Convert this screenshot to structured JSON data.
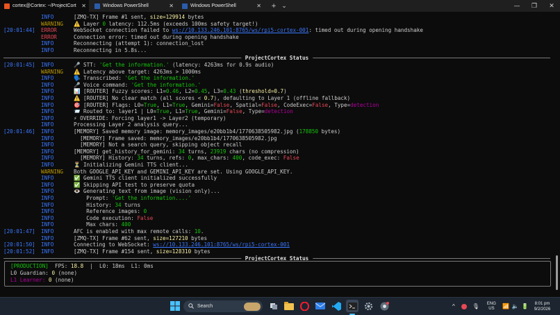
{
  "tabs": [
    {
      "label": "cortex@Cortex: ~/ProjectCort",
      "active": true
    },
    {
      "label": "Windows PowerShell",
      "active": false
    },
    {
      "label": "Windows PowerShell",
      "active": false
    }
  ],
  "tab_controls": {
    "new_tab": "+",
    "dropdown": "⌄"
  },
  "window_controls": {
    "minimize": "—",
    "maximize": "❐",
    "close": "✕"
  },
  "log_block_1": [
    {
      "ts": "",
      "level": "INFO",
      "cls": "",
      "parts": [
        [
          "[ZMQ-TX] Frame #1 sent, ",
          ""
        ],
        [
          "size=129914",
          "yel"
        ],
        [
          " bytes",
          ""
        ]
      ]
    },
    {
      "ts": "",
      "level": "WARNING",
      "cls": "warn",
      "parts": [
        [
          "⚠️ Layer ",
          ""
        ],
        [
          "0",
          "grn"
        ],
        [
          " latency: 112.5ms (exceeds 100ms safety target!)",
          ""
        ]
      ]
    },
    {
      "ts": "[20:01:44]",
      "level": "ERROR",
      "cls": "err",
      "parts": [
        [
          "WebSocket connection failed to ",
          ""
        ],
        [
          "ws://10.133.246.101:8765/ws/rpi5-cortex-001",
          "und"
        ],
        [
          ": timed out during opening handshake",
          ""
        ]
      ]
    },
    {
      "ts": "",
      "level": "ERROR",
      "cls": "err",
      "parts": [
        [
          "Connection error: timed out during opening handshake",
          ""
        ]
      ]
    },
    {
      "ts": "",
      "level": "INFO",
      "cls": "",
      "parts": [
        [
          "Reconnecting (attempt 1): connection_lost",
          ""
        ]
      ]
    },
    {
      "ts": "",
      "level": "INFO",
      "cls": "",
      "parts": [
        [
          "Reconnecting in 5.8s...",
          ""
        ]
      ]
    }
  ],
  "status_title_1": "ProjectCortex Status",
  "log_block_2": [
    {
      "ts": "[20:01:45]",
      "level": "INFO",
      "cls": "",
      "parts": [
        [
          "🎤 STT: ",
          ""
        ],
        [
          "'Get the information.'",
          "grn"
        ],
        [
          " (latency: 4263ms for 0.9s audio)",
          ""
        ]
      ]
    },
    {
      "ts": "",
      "level": "WARNING",
      "cls": "warn",
      "parts": [
        [
          "⚠️ Latency above target: 4263ms > 1000ms",
          ""
        ]
      ]
    },
    {
      "ts": "",
      "level": "INFO",
      "cls": "",
      "parts": [
        [
          "🗣️ Transcribed: ",
          ""
        ],
        [
          "'Get the information.'",
          "grn"
        ]
      ]
    },
    {
      "ts": "",
      "level": "INFO",
      "cls": "",
      "parts": [
        [
          "🎤 Voice command: ",
          ""
        ],
        [
          "'Get the information.'",
          "grn"
        ]
      ]
    },
    {
      "ts": "",
      "level": "INFO",
      "cls": "",
      "parts": [
        [
          "📊 [ROUTER] Fuzzy scores: L1=",
          ""
        ],
        [
          "0.46",
          "grn"
        ],
        [
          ", L2=",
          ""
        ],
        [
          "0.45",
          "grn"
        ],
        [
          ", L3=",
          ""
        ],
        [
          "0.43",
          "grn"
        ],
        [
          " (",
          ""
        ],
        [
          "threshold=0.7",
          "yel"
        ],
        [
          ")",
          ""
        ]
      ]
    },
    {
      "ts": "",
      "level": "INFO",
      "cls": "",
      "parts": [
        [
          "⚠️ [ROUTER] No clear match (all scores < ",
          ""
        ],
        [
          "0.7",
          "yel"
        ],
        [
          "), defaulting to Layer 1 (offline fallback)",
          ""
        ]
      ]
    },
    {
      "ts": "",
      "level": "INFO",
      "cls": "",
      "parts": [
        [
          "🎯 [ROUTER] Flags: L0=",
          ""
        ],
        [
          "True",
          "grn"
        ],
        [
          ", L1=",
          ""
        ],
        [
          "True",
          "grn"
        ],
        [
          ", Gemini=",
          ""
        ],
        [
          "False",
          "red"
        ],
        [
          ", Spatial=",
          ""
        ],
        [
          "False",
          "red"
        ],
        [
          ", CodeExec=",
          ""
        ],
        [
          "False",
          "red"
        ],
        [
          ", Type=",
          ""
        ],
        [
          "detection",
          "mag"
        ]
      ]
    },
    {
      "ts": "",
      "level": "INFO",
      "cls": "",
      "parts": [
        [
          "📨 Routed to: layer1 | L0=",
          ""
        ],
        [
          "True",
          "grn"
        ],
        [
          ", L1=",
          ""
        ],
        [
          "True",
          "grn"
        ],
        [
          ", Gemini=",
          ""
        ],
        [
          "False",
          "red"
        ],
        [
          ", Type=",
          ""
        ],
        [
          "detection",
          "mag"
        ]
      ]
    },
    {
      "ts": "",
      "level": "INFO",
      "cls": "",
      "parts": [
        [
          "⚡ OVERRIDE: Forcing layer1 -> Layer2 (temporary)",
          ""
        ]
      ]
    },
    {
      "ts": "",
      "level": "INFO",
      "cls": "",
      "parts": [
        [
          "Processing Layer 2 analysis query...",
          ""
        ]
      ]
    },
    {
      "ts": "[20:01:46]",
      "level": "INFO",
      "cls": "",
      "parts": [
        [
          "[MEMORY] Saved memory image: memory_images/e20bb1b4/1770638505982.jpg (",
          ""
        ],
        [
          "178850",
          "grn"
        ],
        [
          " bytes)",
          ""
        ]
      ]
    },
    {
      "ts": "",
      "level": "INFO",
      "cls": "",
      "parts": [
        [
          "  [MEMORY] Frame saved: memory_images/e20bb1b4/1770638505982.jpg",
          ""
        ]
      ]
    },
    {
      "ts": "",
      "level": "INFO",
      "cls": "",
      "parts": [
        [
          "  [MEMORY] Not a search query, skipping object recall",
          ""
        ]
      ]
    },
    {
      "ts": "",
      "level": "INFO",
      "cls": "",
      "parts": [
        [
          "[MEMORY] get_history_for_gemini: ",
          ""
        ],
        [
          "34",
          "grn"
        ],
        [
          " turns, ",
          ""
        ],
        [
          "23919",
          "grn"
        ],
        [
          " chars (no compression)",
          ""
        ]
      ]
    },
    {
      "ts": "",
      "level": "INFO",
      "cls": "",
      "parts": [
        [
          "  [MEMORY] History: ",
          ""
        ],
        [
          "34",
          "grn"
        ],
        [
          " turns, refs: ",
          ""
        ],
        [
          "0",
          "grn"
        ],
        [
          ", max_chars: ",
          ""
        ],
        [
          "400",
          "grn"
        ],
        [
          ", code_exec: ",
          ""
        ],
        [
          "False",
          "red"
        ]
      ]
    },
    {
      "ts": "",
      "level": "INFO",
      "cls": "",
      "parts": [
        [
          "⏳ Initializing Gemini TTS client...",
          ""
        ]
      ]
    },
    {
      "ts": "",
      "level": "WARNING",
      "cls": "warn",
      "parts": [
        [
          "Both GOOGLE_API_KEY and GEMINI_API_KEY are set. Using GOOGLE_API_KEY.",
          ""
        ]
      ]
    },
    {
      "ts": "",
      "level": "INFO",
      "cls": "",
      "parts": [
        [
          "✅ Gemini TTS client initialized successfully",
          ""
        ]
      ]
    },
    {
      "ts": "",
      "level": "INFO",
      "cls": "",
      "parts": [
        [
          "✅ Skipping API test to preserve quota",
          ""
        ]
      ]
    },
    {
      "ts": "",
      "level": "INFO",
      "cls": "",
      "parts": [
        [
          "👁️ Generating text from image (vision only)...",
          ""
        ]
      ]
    },
    {
      "ts": "",
      "level": "INFO",
      "cls": "",
      "parts": [
        [
          "    Prompt: ",
          ""
        ],
        [
          "'Get the information....'",
          "grn"
        ]
      ]
    },
    {
      "ts": "",
      "level": "INFO",
      "cls": "",
      "parts": [
        [
          "    History: ",
          ""
        ],
        [
          "34",
          "grn"
        ],
        [
          " turns",
          ""
        ]
      ]
    },
    {
      "ts": "",
      "level": "INFO",
      "cls": "",
      "parts": [
        [
          "    Reference images: ",
          ""
        ],
        [
          "0",
          "grn"
        ]
      ]
    },
    {
      "ts": "",
      "level": "INFO",
      "cls": "",
      "parts": [
        [
          "    Code execution: ",
          ""
        ],
        [
          "False",
          "red"
        ]
      ]
    },
    {
      "ts": "",
      "level": "INFO",
      "cls": "",
      "parts": [
        [
          "    Max chars: ",
          ""
        ],
        [
          "400",
          "grn"
        ]
      ]
    },
    {
      "ts": "[20:01:47]",
      "level": "INFO",
      "cls": "",
      "parts": [
        [
          "AFC is enabled with max remote calls: ",
          ""
        ],
        [
          "10",
          "grn"
        ],
        [
          ".",
          ""
        ]
      ]
    },
    {
      "ts": "",
      "level": "INFO",
      "cls": "",
      "parts": [
        [
          "[ZMQ-TX] Frame #62 sent, ",
          ""
        ],
        [
          "size=127210",
          "yel"
        ],
        [
          " bytes",
          ""
        ]
      ]
    },
    {
      "ts": "[20:01:50]",
      "level": "INFO",
      "cls": "",
      "parts": [
        [
          "Connecting to WebSocket: ",
          ""
        ],
        [
          "ws://10.133.246.101:8765/ws/rpi5-cortex-001",
          "und"
        ]
      ]
    },
    {
      "ts": "[20:01:52]",
      "level": "INFO",
      "cls": "",
      "parts": [
        [
          "[ZMQ-TX] Frame #154 sent, ",
          ""
        ],
        [
          "size=128310",
          "yel"
        ],
        [
          " bytes",
          ""
        ]
      ]
    }
  ],
  "status_title_2": "ProjectCortex Status",
  "status_panel": [
    [
      [
        "[PRODUCTION]",
        "grn"
      ],
      [
        "  FPS: ",
        ""
      ],
      [
        "18.8",
        "yel"
      ],
      [
        "  |  L0: 18ms  L1: 0ms",
        ""
      ]
    ],
    [
      [
        "L0 Guardian:",
        ""
      ],
      [
        " ",
        ""
      ],
      [
        "0",
        "yel"
      ],
      [
        " (none)",
        ""
      ]
    ],
    [
      [
        "L1 Learner:",
        "mag"
      ],
      [
        " ",
        ""
      ],
      [
        "0",
        "yel"
      ],
      [
        " (none)",
        ""
      ]
    ]
  ],
  "taskbar": {
    "search_placeholder": "Search",
    "lang_top": "ENG",
    "lang_bottom": "US",
    "time": "8:01 pm",
    "date": "9/2/2026"
  },
  "colors": {
    "accent": "#3b78ff",
    "warning": "#c19c00",
    "error": "#e74856",
    "green": "#16c60c",
    "yellow": "#f9f1a5",
    "magenta": "#b4009e"
  }
}
